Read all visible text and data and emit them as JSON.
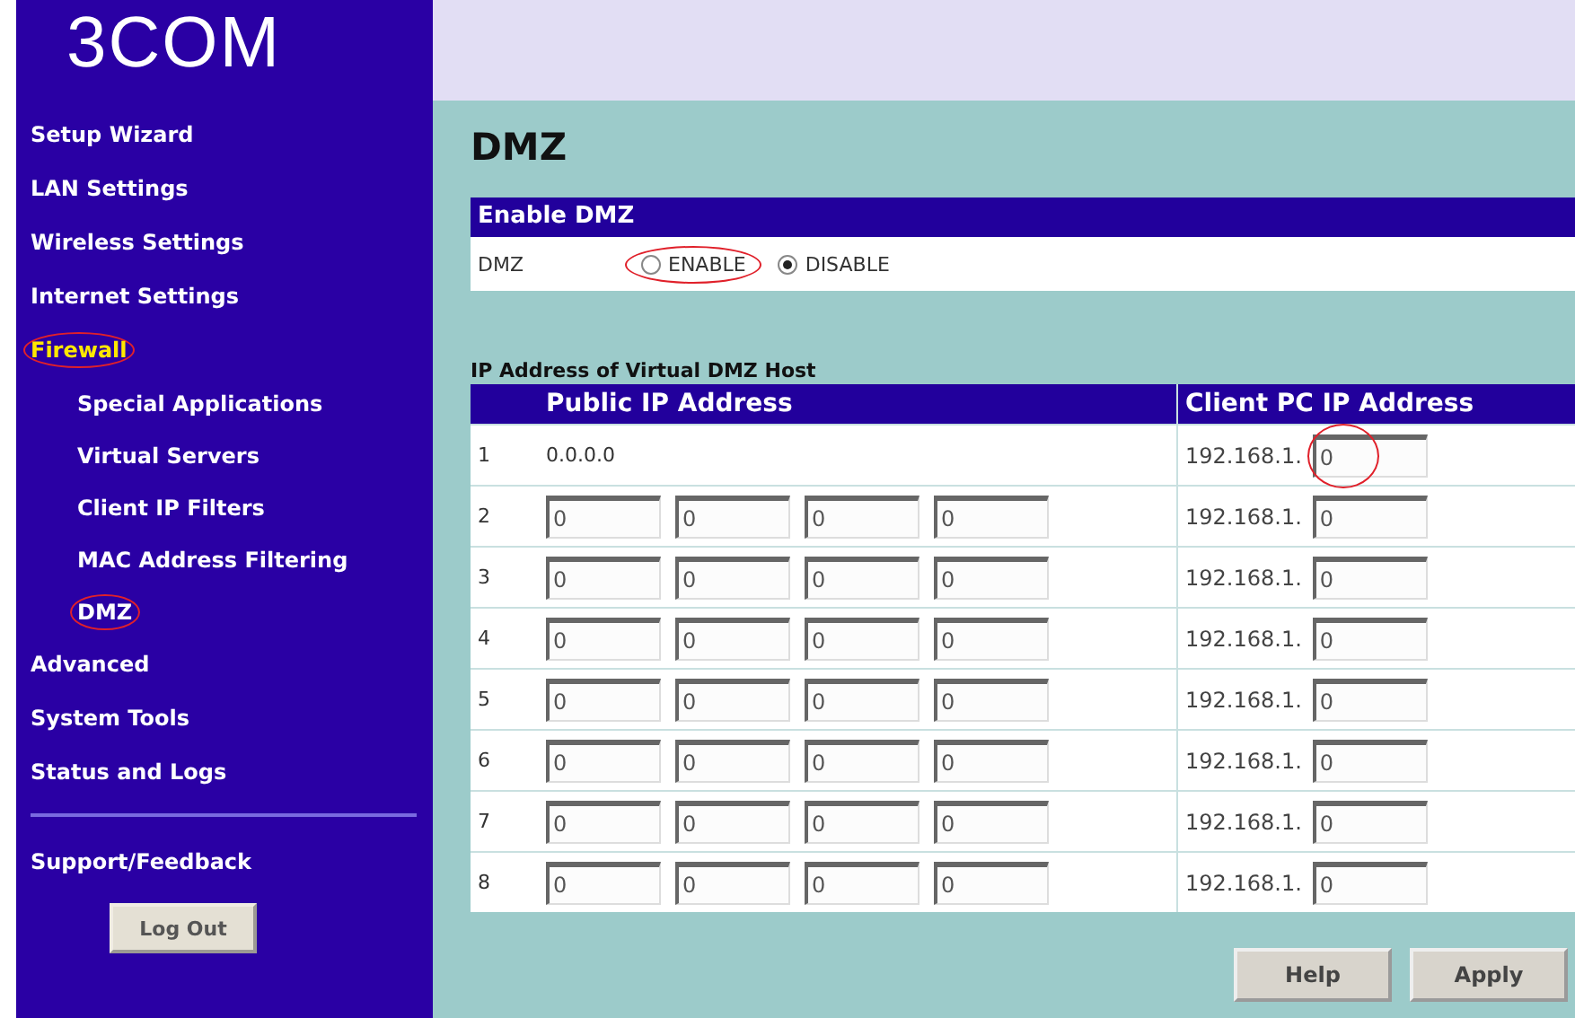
{
  "logo": "3COM",
  "sidebar": {
    "items": [
      {
        "label": "Setup Wizard",
        "selected": false,
        "circled": false
      },
      {
        "label": "LAN Settings",
        "selected": false,
        "circled": false
      },
      {
        "label": "Wireless Settings",
        "selected": false,
        "circled": false
      },
      {
        "label": "Internet Settings",
        "selected": false,
        "circled": false
      },
      {
        "label": "Firewall",
        "selected": true,
        "circled": true,
        "children": [
          {
            "label": "Special Applications",
            "selected": false,
            "circled": false
          },
          {
            "label": "Virtual Servers",
            "selected": false,
            "circled": false
          },
          {
            "label": "Client IP Filters",
            "selected": false,
            "circled": false
          },
          {
            "label": "MAC Address Filtering",
            "selected": false,
            "circled": false
          },
          {
            "label": "DMZ",
            "selected": false,
            "circled": true
          }
        ]
      },
      {
        "label": "Advanced",
        "selected": false,
        "circled": false
      },
      {
        "label": "System Tools",
        "selected": false,
        "circled": false
      },
      {
        "label": "Status and Logs",
        "selected": false,
        "circled": false
      }
    ],
    "footer_link": "Support/Feedback",
    "logout": "Log Out"
  },
  "page_title": "DMZ",
  "enable_panel": {
    "title": "Enable DMZ",
    "label": "DMZ",
    "options": [
      {
        "label": "ENABLE",
        "selected": false,
        "circled": true
      },
      {
        "label": "DISABLE",
        "selected": true,
        "circled": false
      }
    ]
  },
  "host_section": {
    "title": "IP Address of Virtual DMZ Host",
    "columns": [
      "Public IP Address",
      "Client PC IP Address"
    ],
    "rows": [
      {
        "index": "1",
        "kind": "text",
        "public": "0.0.0.0",
        "prefix": "192.168.1.",
        "client": "0",
        "circled": true
      },
      {
        "index": "2",
        "kind": "fields",
        "public": [
          "0",
          "0",
          "0",
          "0"
        ],
        "prefix": "192.168.1.",
        "client": "0",
        "circled": false
      },
      {
        "index": "3",
        "kind": "fields",
        "public": [
          "0",
          "0",
          "0",
          "0"
        ],
        "prefix": "192.168.1.",
        "client": "0",
        "circled": false
      },
      {
        "index": "4",
        "kind": "fields",
        "public": [
          "0",
          "0",
          "0",
          "0"
        ],
        "prefix": "192.168.1.",
        "client": "0",
        "circled": false
      },
      {
        "index": "5",
        "kind": "fields",
        "public": [
          "0",
          "0",
          "0",
          "0"
        ],
        "prefix": "192.168.1.",
        "client": "0",
        "circled": false
      },
      {
        "index": "6",
        "kind": "fields",
        "public": [
          "0",
          "0",
          "0",
          "0"
        ],
        "prefix": "192.168.1.",
        "client": "0",
        "circled": false
      },
      {
        "index": "7",
        "kind": "fields",
        "public": [
          "0",
          "0",
          "0",
          "0"
        ],
        "prefix": "192.168.1.",
        "client": "0",
        "circled": false
      },
      {
        "index": "8",
        "kind": "fields",
        "public": [
          "0",
          "0",
          "0",
          "0"
        ],
        "prefix": "192.168.1.",
        "client": "0",
        "circled": false
      }
    ]
  },
  "buttons": [
    "Help",
    "Apply"
  ]
}
